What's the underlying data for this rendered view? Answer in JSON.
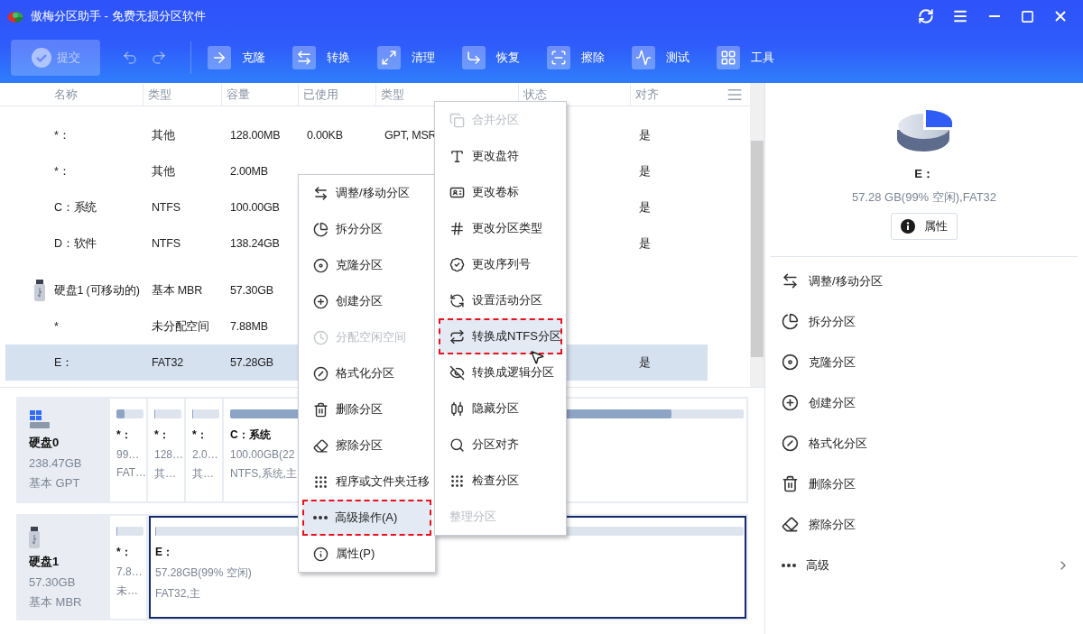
{
  "window": {
    "title": "傲梅分区助手 - 免费无损分区软件"
  },
  "toolbar": {
    "submit": {
      "label": "提交",
      "disabled": true
    },
    "history": [
      {
        "kind": "undo",
        "disabled": true
      },
      {
        "kind": "redo",
        "disabled": true
      }
    ],
    "tools": [
      {
        "label": "克隆"
      },
      {
        "label": "转换"
      },
      {
        "label": "清理"
      },
      {
        "label": "恢复"
      },
      {
        "label": "擦除"
      },
      {
        "label": "测试"
      },
      {
        "label": "工具"
      }
    ]
  },
  "table": {
    "columns": [
      "名称",
      "类型",
      "容量",
      "已使用",
      "类型",
      "状态",
      "对齐"
    ],
    "rows": [
      {
        "kind": "partition",
        "selected": false,
        "name": "*：",
        "type": "其他",
        "capacity": "128.00MB",
        "used": "0.00KB",
        "fs": "GPT, MSR",
        "align": "是"
      },
      {
        "kind": "partition",
        "selected": false,
        "name": "*：",
        "type": "其他",
        "capacity": "2.00MB",
        "align": "是"
      },
      {
        "kind": "partition",
        "selected": false,
        "name": "C：系统",
        "type": "NTFS",
        "capacity": "100.00GB",
        "align": "是"
      },
      {
        "kind": "partition",
        "selected": false,
        "name": "D：软件",
        "type": "NTFS",
        "capacity": "138.24GB",
        "align": "是"
      },
      {
        "kind": "disk",
        "selected": false,
        "name": "硬盘1 (可移动的)",
        "type": "基本 MBR",
        "capacity": "57.30GB"
      },
      {
        "kind": "partition",
        "selected": false,
        "name": "*",
        "type": "未分配空间",
        "capacity": "7.88MB"
      },
      {
        "kind": "partition",
        "selected": true,
        "name": "E：",
        "type": "FAT32",
        "capacity": "57.28GB",
        "align": "是"
      }
    ]
  },
  "disk_map": [
    {
      "kind": "system",
      "name": "硬盘0",
      "size": "238.47GB",
      "style": "基本 GPT",
      "partitions": [
        {
          "name": "*：",
          "size": "99…",
          "fs": "FAT…",
          "level": 0.3,
          "selected": false,
          "wide": false
        },
        {
          "name": "*：",
          "size": "128…",
          "fs": "其…",
          "level": 0,
          "selected": false,
          "wide": false
        },
        {
          "name": "*：",
          "size": "2.0…",
          "fs": "其…",
          "level": 0,
          "selected": false,
          "wide": false
        },
        {
          "name": "C：系统",
          "size": "100.00GB(22",
          "fs": "NTFS,系统,主",
          "level": 0.86,
          "selected": false,
          "wide": true
        }
      ]
    },
    {
      "kind": "usb",
      "name": "硬盘1",
      "size": "57.30GB",
      "style": "基本 MBR",
      "partitions": [
        {
          "name": "*：",
          "size": "7.8…",
          "fs": "未…",
          "level": 0,
          "selected": false,
          "wide": false
        },
        {
          "name": "E：",
          "size": "57.28GB(99% 空闲)",
          "fs": "FAT32,主",
          "level": 0,
          "selected": true,
          "wide": true
        }
      ]
    }
  ],
  "details": {
    "title": "E：",
    "info": "57.28 GB(99% 空闲),FAT32",
    "button": "属性",
    "actions": [
      {
        "label": "调整/移动分区",
        "kind": "action"
      },
      {
        "label": "拆分分区",
        "kind": "action"
      },
      {
        "label": "克隆分区",
        "kind": "action"
      },
      {
        "label": "创建分区",
        "kind": "action"
      },
      {
        "label": "格式化分区",
        "kind": "action"
      },
      {
        "label": "删除分区",
        "kind": "action"
      },
      {
        "label": "擦除分区",
        "kind": "action"
      },
      {
        "label": "高级",
        "kind": "submenu"
      }
    ]
  },
  "context_menu": {
    "items": [
      {
        "label": "调整/移动分区",
        "disabled": false,
        "selected": false
      },
      {
        "label": "拆分分区",
        "disabled": false,
        "selected": false
      },
      {
        "label": "克隆分区",
        "disabled": false,
        "selected": false
      },
      {
        "label": "创建分区",
        "disabled": false,
        "selected": false
      },
      {
        "label": "分配空闲空间",
        "disabled": true,
        "selected": false
      },
      {
        "label": "格式化分区",
        "disabled": false,
        "selected": false
      },
      {
        "label": "删除分区",
        "disabled": false,
        "selected": false
      },
      {
        "label": "擦除分区",
        "disabled": false,
        "selected": false
      },
      {
        "label": "程序或文件夹迁移",
        "disabled": false,
        "selected": false
      },
      {
        "label": "高级操作(A)",
        "disabled": false,
        "selected": true
      },
      {
        "label": "属性(P)",
        "disabled": false,
        "selected": false
      }
    ]
  },
  "submenu": {
    "items": [
      {
        "label": "合并分区",
        "disabled": true,
        "selected": false
      },
      {
        "label": "更改盘符",
        "disabled": false,
        "selected": false
      },
      {
        "label": "更改卷标",
        "disabled": false,
        "selected": false
      },
      {
        "label": "更改分区类型",
        "disabled": false,
        "selected": false
      },
      {
        "label": "更改序列号",
        "disabled": false,
        "selected": false
      },
      {
        "label": "设置活动分区",
        "disabled": false,
        "selected": false
      },
      {
        "label": "转换成NTFS分区",
        "disabled": false,
        "selected": true
      },
      {
        "label": "转换成逻辑分区",
        "disabled": false,
        "selected": false
      },
      {
        "label": "隐藏分区",
        "disabled": false,
        "selected": false
      },
      {
        "label": "分区对齐",
        "disabled": false,
        "selected": false
      },
      {
        "label": "检查分区",
        "disabled": false,
        "selected": false
      },
      {
        "label": "整理分区",
        "disabled": true,
        "selected": false
      }
    ]
  }
}
